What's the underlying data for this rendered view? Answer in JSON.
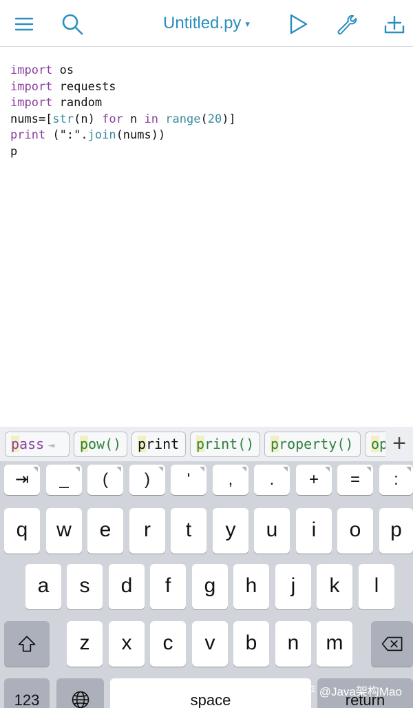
{
  "toolbar": {
    "file_title": "Untitled.py",
    "title_caret": "▾",
    "icons": [
      "menu-icon",
      "search-icon",
      "run-icon",
      "wrench-icon",
      "add-icon"
    ],
    "accent_color": "#2a8fbd"
  },
  "editor": {
    "lines": [
      {
        "kw": "import",
        "rest": " os"
      },
      {
        "kw": "import",
        "rest": " requests"
      },
      {
        "kw": "import",
        "rest": " random"
      }
    ],
    "line4": {
      "a": "nums=[",
      "b": "str",
      "c": "(n) ",
      "d": "for",
      "e": " n ",
      "f": "in",
      "g": " ",
      "h": "range",
      "i": "(",
      "j": "20",
      "k": ")]"
    },
    "line5": {
      "a": "print",
      "b": " (\":\".",
      "c": "join",
      "d": "(nums))"
    },
    "line6": "p"
  },
  "suggestions": {
    "pass": {
      "hl": "p",
      "rest": "ass",
      "arrow": "⇥"
    },
    "pow": {
      "hl": "p",
      "rest": "ow()"
    },
    "print": {
      "hl": "p",
      "rest": "rint"
    },
    "print_call": {
      "hl": "p",
      "rest": "rint()"
    },
    "property": {
      "hl": "p",
      "rest": "roperty()"
    },
    "open_partial": {
      "hl": "o",
      "rest": "p"
    },
    "plus": "+"
  },
  "symbol_keys": [
    "⇥",
    "_",
    "(",
    ")",
    "'",
    ",",
    ".",
    "+",
    "=",
    ":"
  ],
  "row1": [
    "q",
    "w",
    "e",
    "r",
    "t",
    "y",
    "u",
    "i",
    "o",
    "p"
  ],
  "row2": [
    "a",
    "s",
    "d",
    "f",
    "g",
    "h",
    "j",
    "k",
    "l"
  ],
  "row3": [
    "z",
    "x",
    "c",
    "v",
    "b",
    "n",
    "m"
  ],
  "row4": {
    "numbers": "123",
    "space": "space",
    "return": "return"
  },
  "watermark": "知乎 @Java架构Mao"
}
